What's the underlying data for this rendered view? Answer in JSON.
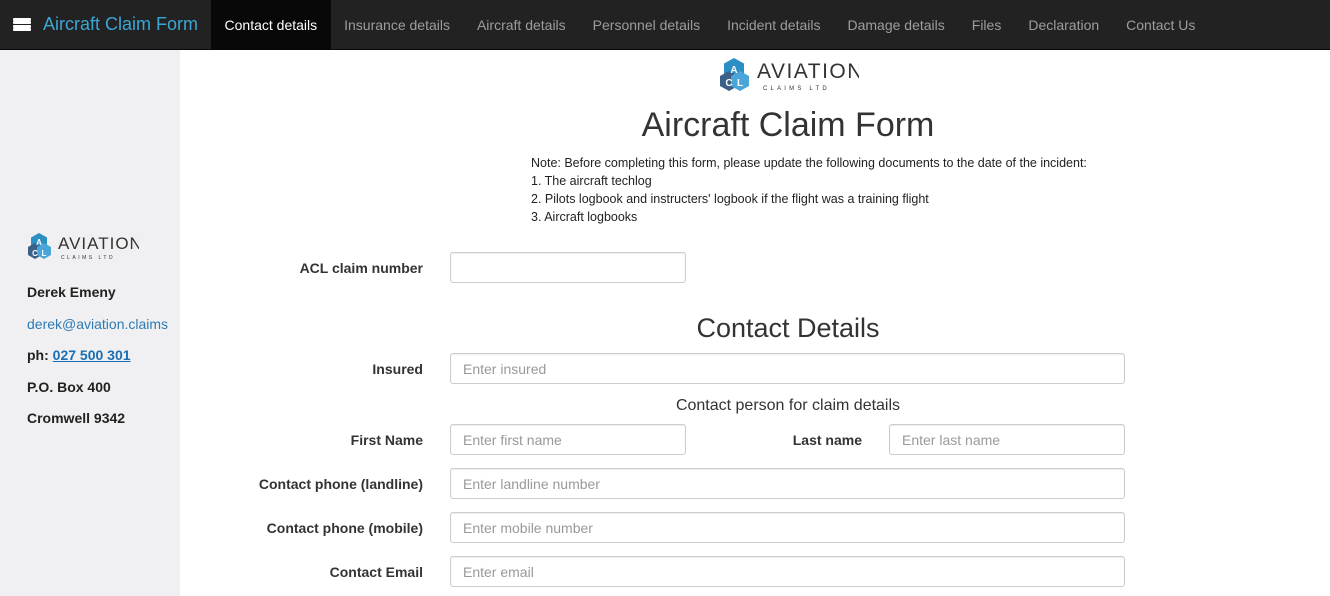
{
  "navbar": {
    "brand": "Aircraft Claim Form",
    "items": [
      {
        "label": "Contact details",
        "active": true
      },
      {
        "label": "Insurance details",
        "active": false
      },
      {
        "label": "Aircraft details",
        "active": false
      },
      {
        "label": "Personnel details",
        "active": false
      },
      {
        "label": "Incident details",
        "active": false
      },
      {
        "label": "Damage details",
        "active": false
      },
      {
        "label": "Files",
        "active": false
      },
      {
        "label": "Declaration",
        "active": false
      },
      {
        "label": "Contact Us",
        "active": false
      }
    ]
  },
  "logo": {
    "letters": [
      "A",
      "C",
      "L"
    ],
    "word": "AVIATION",
    "tagline": "CLAIMS LTD"
  },
  "sidebar": {
    "name": "Derek Emeny",
    "email": "derek@aviation.claims",
    "phone_prefix": "ph: ",
    "phone": "027 500 301",
    "po_box": "P.O. Box 400",
    "city": "Cromwell 9342"
  },
  "main": {
    "title": "Aircraft Claim Form",
    "note": {
      "intro": "Note: Before completing this form, please update the following documents to the date of the incident:",
      "items": [
        "1. The aircraft techlog",
        "2. Pilots logbook and instructers' logbook if the flight was a training flight",
        "3. Aircraft logbooks"
      ]
    },
    "acl_claim": {
      "label": "ACL claim number",
      "value": "",
      "placeholder": ""
    },
    "contact_section_title": "Contact Details",
    "insured": {
      "label": "Insured",
      "placeholder": "Enter insured"
    },
    "contact_person_title": "Contact person for claim details",
    "first_name": {
      "label": "First Name",
      "placeholder": "Enter first name"
    },
    "last_name": {
      "label": "Last name",
      "placeholder": "Enter last name"
    },
    "landline": {
      "label": "Contact phone (landline)",
      "placeholder": "Enter landline number"
    },
    "mobile": {
      "label": "Contact phone (mobile)",
      "placeholder": "Enter mobile number"
    },
    "email": {
      "label": "Contact Email",
      "placeholder": "Enter email"
    }
  },
  "colors": {
    "navbar_bg": "#222222",
    "brand": "#3aa6d6",
    "sidebar_bg": "#f0f0f2",
    "link": "#2e7bb5",
    "logo_blue": "#2c8fc4",
    "logo_dark": "#3b5f86"
  }
}
